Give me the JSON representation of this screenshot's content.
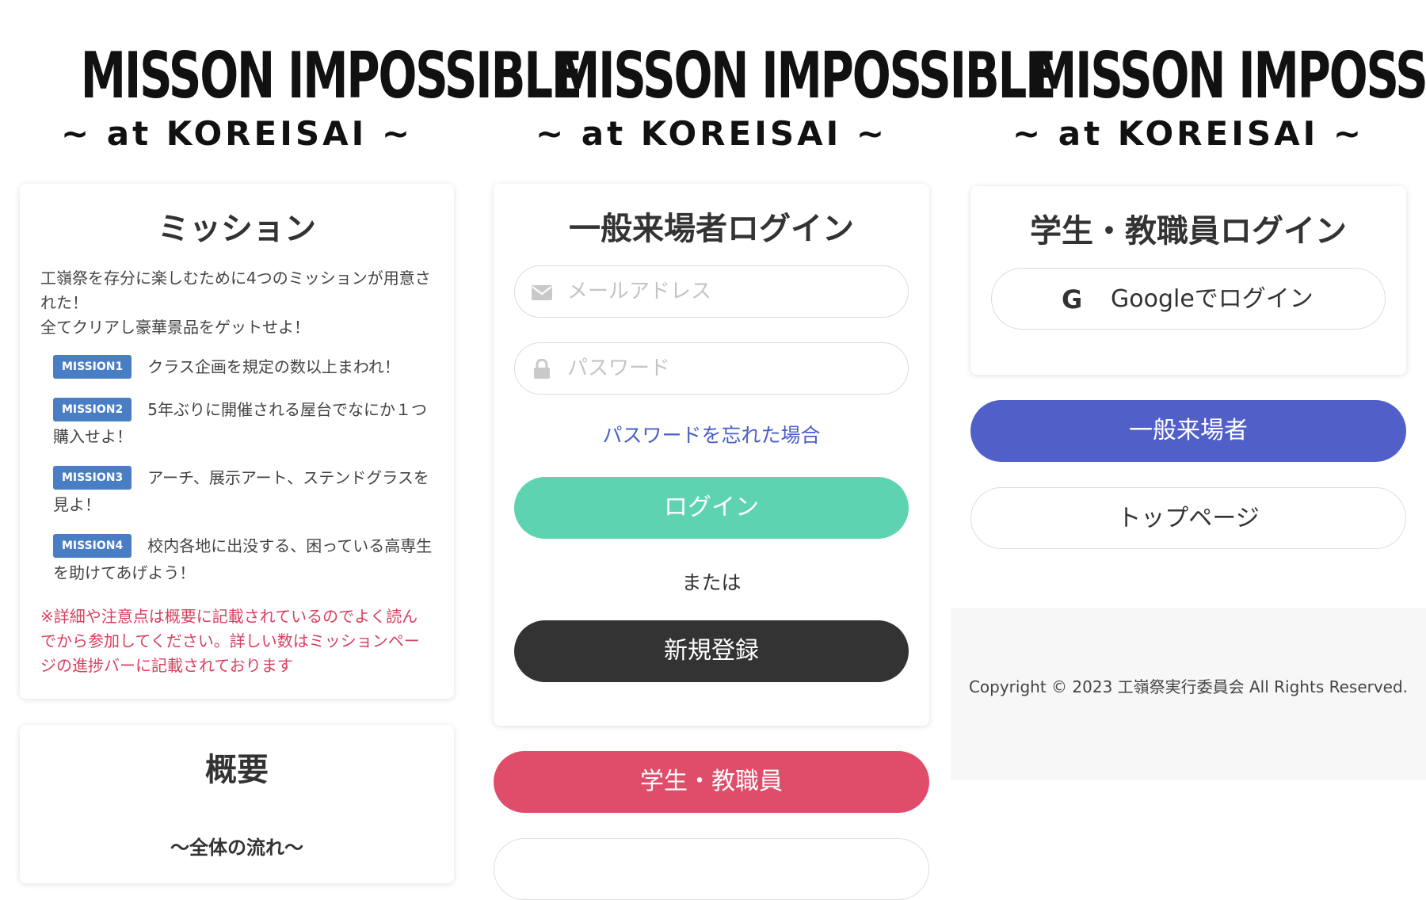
{
  "logo": {
    "title": "MISSON IMPOSSIBLE",
    "subtitle": "~ at KOREISAI ~"
  },
  "mission": {
    "title": "ミッション",
    "intro": "工嶺祭を存分に楽しむために4つのミッションが用意された！\n全てクリアし豪華景品をゲットせよ！",
    "items": [
      {
        "badge": "MISSION1",
        "text": "クラス企画を規定の数以上まわれ！"
      },
      {
        "badge": "MISSION2",
        "text": "5年ぶりに開催される屋台でなにか１つ購入せよ！"
      },
      {
        "badge": "MISSION3",
        "text": "アーチ、展示アート、ステンドグラスを見よ！"
      },
      {
        "badge": "MISSION4",
        "text": "校内各地に出没する、困っている高専生を助けてあげよう！"
      }
    ],
    "note": "※詳細や注意点は概要に記載されているのでよく読んでから参加してください。詳しい数はミッションページの進捗バーに記載されております"
  },
  "summary": {
    "title": "概要",
    "subtitle": "〜全体の流れ〜"
  },
  "guest_login": {
    "title": "一般来場者ログイン",
    "email_placeholder": "メールアドレス",
    "password_placeholder": "パスワード",
    "email_icon": "envelope-icon",
    "password_icon": "lock-icon",
    "forgot_label": "パスワードを忘れた場合",
    "login_label": "ログイン",
    "or_label": "または",
    "register_label": "新規登録"
  },
  "switch_buttons": {
    "staff_label": "学生・教職員"
  },
  "staff_login": {
    "title": "学生・教職員ログイン",
    "google_icon": "google-icon",
    "google_logo": "G",
    "google_label": "Googleでログイン"
  },
  "nav": {
    "guest_label": "一般来場者",
    "top_label": "トップページ"
  },
  "footer": {
    "copyright": "Copyright © 2023 工嶺祭実行委員会 All Rights Reserved."
  },
  "colors": {
    "login": "#5dd3b2",
    "register": "#333333",
    "staff": "#e04d6a",
    "guest": "#5060c8",
    "badge": "#4a7ec4",
    "note": "#d8405f",
    "link": "#4a5fc8"
  }
}
